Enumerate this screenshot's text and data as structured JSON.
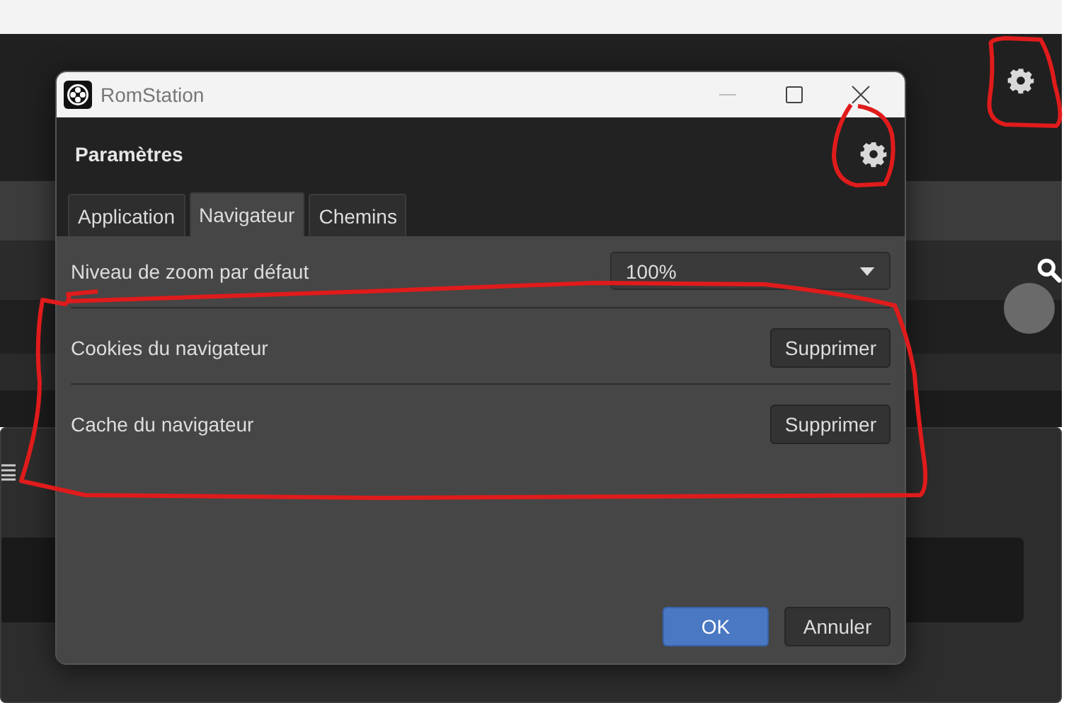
{
  "window": {
    "title": "RomStation"
  },
  "header": {
    "title": "Paramètres"
  },
  "tabs": [
    {
      "label": "Application",
      "selected": false
    },
    {
      "label": "Navigateur",
      "selected": true
    },
    {
      "label": "Chemins",
      "selected": false
    }
  ],
  "settings": [
    {
      "kind": "dropdown",
      "label": "Niveau de zoom par défaut",
      "value": "100%"
    },
    {
      "kind": "button",
      "label": "Cookies du navigateur",
      "action": "Supprimer"
    },
    {
      "kind": "button",
      "label": "Cache du navigateur",
      "action": "Supprimer"
    }
  ],
  "buttons": [
    {
      "label": "OK",
      "primary": true
    },
    {
      "label": "Annuler",
      "primary": false
    }
  ]
}
